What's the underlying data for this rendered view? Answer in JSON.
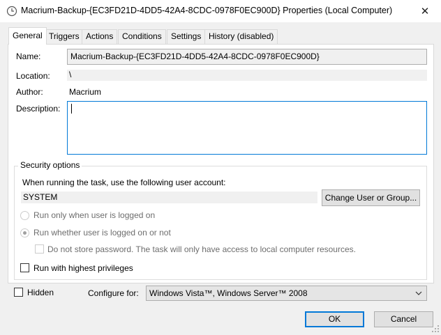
{
  "window": {
    "title": "Macrium-Backup-{EC3FD21D-4DD5-42A4-8CDC-0978F0EC900D} Properties (Local Computer)",
    "close_glyph": "✕"
  },
  "tabs": [
    {
      "label": "General",
      "active": true
    },
    {
      "label": "Triggers"
    },
    {
      "label": "Actions"
    },
    {
      "label": "Conditions"
    },
    {
      "label": "Settings"
    },
    {
      "label": "History (disabled)"
    }
  ],
  "general": {
    "name_label": "Name:",
    "name_value": "Macrium-Backup-{EC3FD21D-4DD5-42A4-8CDC-0978F0EC900D}",
    "location_label": "Location:",
    "location_value": "\\",
    "author_label": "Author:",
    "author_value": "Macrium",
    "description_label": "Description:",
    "description_value": ""
  },
  "security": {
    "group_title": "Security options",
    "account_prompt": "When running the task, use the following user account:",
    "account_value": "SYSTEM",
    "change_button": "Change User or Group...",
    "radio_logged_on": "Run only when user is logged on",
    "radio_whether": "Run whether user is logged on or not",
    "no_store_password": "Do not store password.  The task will only have access to local computer resources.",
    "highest_privileges": "Run with highest privileges"
  },
  "footer": {
    "hidden_label": "Hidden",
    "configure_label": "Configure for:",
    "configure_value": "Windows Vista™, Windows Server™ 2008",
    "ok_button": "OK",
    "cancel_button": "Cancel"
  },
  "colors": {
    "accent": "#0078d7",
    "window_bg": "#f0f0f0",
    "panel_bg": "#ffffff",
    "disabled_text": "#6d6d6d"
  }
}
